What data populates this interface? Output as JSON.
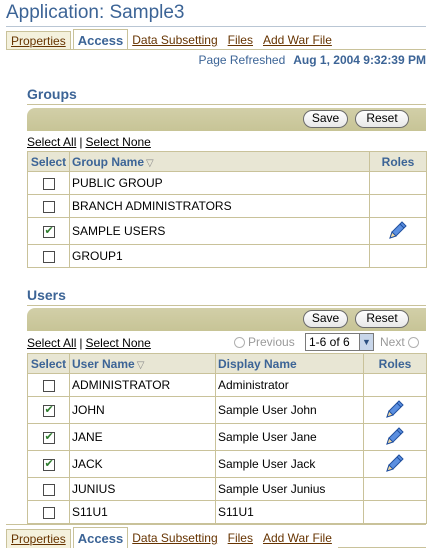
{
  "app": {
    "title": "Application: Sample3"
  },
  "tabs": [
    "Properties",
    "Access",
    "Data Subsetting",
    "Files",
    "Add War File"
  ],
  "refresh": {
    "label": "Page Refreshed",
    "timestamp": "Aug 1, 2004 9:32:39 PM"
  },
  "groups": {
    "heading": "Groups",
    "save_label": "Save",
    "reset_label": "Reset",
    "select_all": "Select All",
    "select_none": "Select None",
    "separator": "|",
    "columns": {
      "select": "Select",
      "name": "Group Name",
      "roles": "Roles"
    },
    "rows": [
      {
        "name": "PUBLIC GROUP",
        "checked": false,
        "roles_icon": ""
      },
      {
        "name": "BRANCH ADMINISTRATORS",
        "checked": false,
        "roles_icon": ""
      },
      {
        "name": "SAMPLE USERS",
        "checked": true,
        "roles_icon": "pencil-icon"
      },
      {
        "name": "GROUP1",
        "checked": false,
        "roles_icon": ""
      }
    ]
  },
  "users": {
    "heading": "Users",
    "save_label": "Save",
    "reset_label": "Reset",
    "select_all": "Select All",
    "select_none": "Select None",
    "separator": "|",
    "previous_label": "Previous",
    "next_label": "Next",
    "range_value": "1-6 of 6",
    "columns": {
      "select": "Select",
      "user": "User Name",
      "display": "Display Name",
      "roles": "Roles"
    },
    "rows": [
      {
        "user": "ADMINISTRATOR",
        "display": "Administrator",
        "checked": false,
        "roles_icon": ""
      },
      {
        "user": "JOHN",
        "display": "Sample User John",
        "checked": true,
        "roles_icon": "pencil-icon"
      },
      {
        "user": "JANE",
        "display": "Sample User Jane",
        "checked": true,
        "roles_icon": "pencil-icon"
      },
      {
        "user": "JACK",
        "display": "Sample User Jack",
        "checked": true,
        "roles_icon": "pencil-icon"
      },
      {
        "user": "JUNIUS",
        "display": "Sample User Junius",
        "checked": false,
        "roles_icon": ""
      },
      {
        "user": "S11U1",
        "display": "S11U1",
        "checked": false,
        "roles_icon": ""
      }
    ]
  },
  "colors": {
    "accent": "#3c6496",
    "link": "#663300",
    "bar": "#c7c496",
    "check": "#2e7d2e",
    "pencil": "#2f6fd0"
  }
}
